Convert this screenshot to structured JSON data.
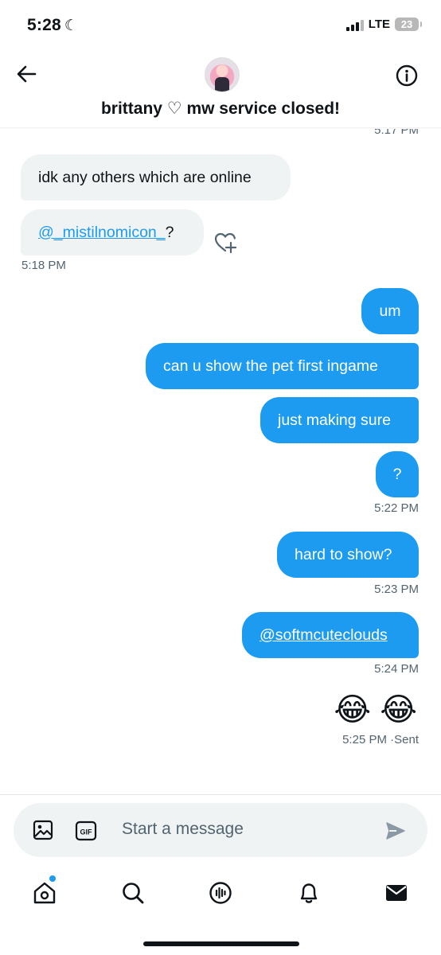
{
  "status_bar": {
    "time": "5:28",
    "network": "LTE",
    "battery": "23"
  },
  "header": {
    "title": "brittany ♡ mw service closed!"
  },
  "messages": {
    "ts0": "5:17 PM",
    "m1": "idk any others which are online",
    "m2_link": "@_mistilnomicon_",
    "m2_suffix": " ?",
    "ts1": "5:18 PM",
    "m3": "um",
    "m4": "can u show the pet first ingame",
    "m5": "just making sure",
    "m6": "?",
    "ts2": "5:22 PM",
    "m7": "hard to show?",
    "ts3": "5:23 PM",
    "m8": "@softmcuteclouds",
    "ts4": "5:24 PM",
    "m9": "😂 😂",
    "ts5": "5:25 PM",
    "ts5_status": "·Sent"
  },
  "composer": {
    "placeholder": "Start a message"
  },
  "icons": {
    "back": "arrow-left-icon",
    "info": "info-icon",
    "react": "heart-plus-icon",
    "image": "image-icon",
    "gif": "gif-icon",
    "send": "send-icon",
    "home": "home-icon",
    "search": "search-icon",
    "spaces": "spaces-icon",
    "notifications": "bell-icon",
    "messages": "envelope-icon"
  },
  "colors": {
    "accent": "#1d9bf0",
    "received_bubble": "#eff3f4",
    "muted": "#536471"
  }
}
